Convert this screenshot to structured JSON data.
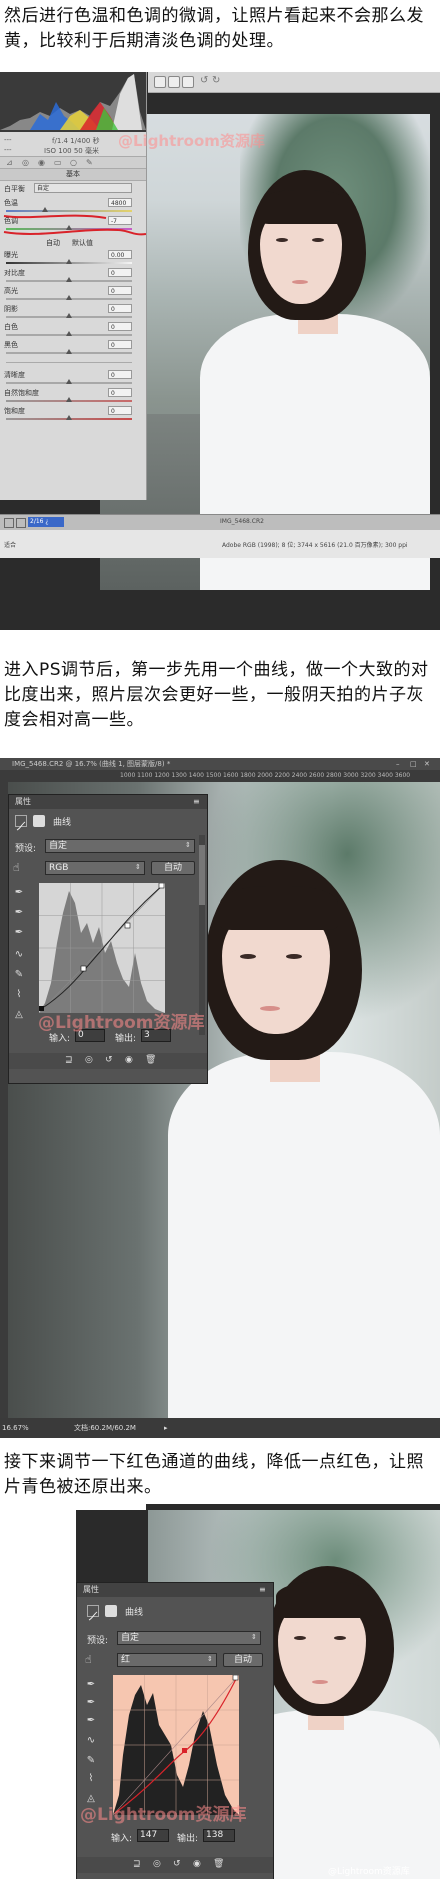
{
  "text1": "然后进行色温和色调的微调，让照片看起来不会那么发黄，比较利于后期清淡色调的处理。",
  "text2": "进入PS调节后，第一步先用一个曲线，做一个大致的对比度出来，照片层次会更好一些，一般阴天拍的片子灰度会相对高一些。",
  "text3": "接下来调节一下红色通道的曲线，降低一点红色，让照片青色被还原出来。",
  "watermark": "@Lightroom资源库",
  "corner_watermark": "@Lightroom资源库",
  "lightroom": {
    "meta_left": "---",
    "exposure_info": "f/1.4  1/400 秒",
    "iso_info": "ISO 100   50 毫米",
    "panel_title": "基本",
    "wb_label": "白平衡",
    "wb_value": "自定",
    "temp_label": "色温",
    "temp_value": "4800",
    "tint_label": "色调",
    "tint_value": "-7",
    "tone_auto": "自动",
    "tone_default": "默认值",
    "sliders": [
      {
        "label": "曝光",
        "value": "0.00"
      },
      {
        "label": "对比度",
        "value": "0"
      },
      {
        "label": "高光",
        "value": "0"
      },
      {
        "label": "阴影",
        "value": "0"
      },
      {
        "label": "白色",
        "value": "0"
      },
      {
        "label": "黑色",
        "value": "0"
      }
    ],
    "presence": [
      {
        "label": "清晰度",
        "value": "0"
      },
      {
        "label": "自然饱和度",
        "value": "0"
      },
      {
        "label": "饱和度",
        "value": "0"
      }
    ],
    "zoom": "适合",
    "filename": "IMG_5468.CR2",
    "bottom_left": "2/16 ¿",
    "filmstrip_info": "Adobe RGB (1998); 8 位; 3744 x 5616 (21.0 百万像素); 300 ppi"
  },
  "photoshop": {
    "tab_title": "IMG_5468.CR2 @ 16.7% (曲线 1, 图层蒙版/8) *",
    "ruler": "1000  1100  1200  1300  1400  1500  1600  1800  2000  2200  2400  2600  2800  3000  3200  3400  3600",
    "panel_tab": "属性",
    "panel_title": "曲线",
    "preset_label": "预设:",
    "preset_value": "自定",
    "channel_value": "RGB",
    "auto_label": "自动",
    "input_label": "输入:",
    "input_value": "0",
    "output_label": "输出:",
    "output_value": "3",
    "status_zoom": "16.67%",
    "status_doc": "文档:60.2M/60.2M"
  },
  "photoshop2": {
    "panel_tab": "属性",
    "panel_title": "曲线",
    "preset_label": "预设:",
    "preset_value": "自定",
    "channel_value": "红",
    "auto_label": "自动",
    "input_label": "输入:",
    "input_value": "147",
    "output_label": "输出:",
    "output_value": "138"
  },
  "colors": {
    "annotation_red": "#d9232a",
    "panel_gray": "#535353",
    "curve_red_bg": "#f6c6b0"
  }
}
